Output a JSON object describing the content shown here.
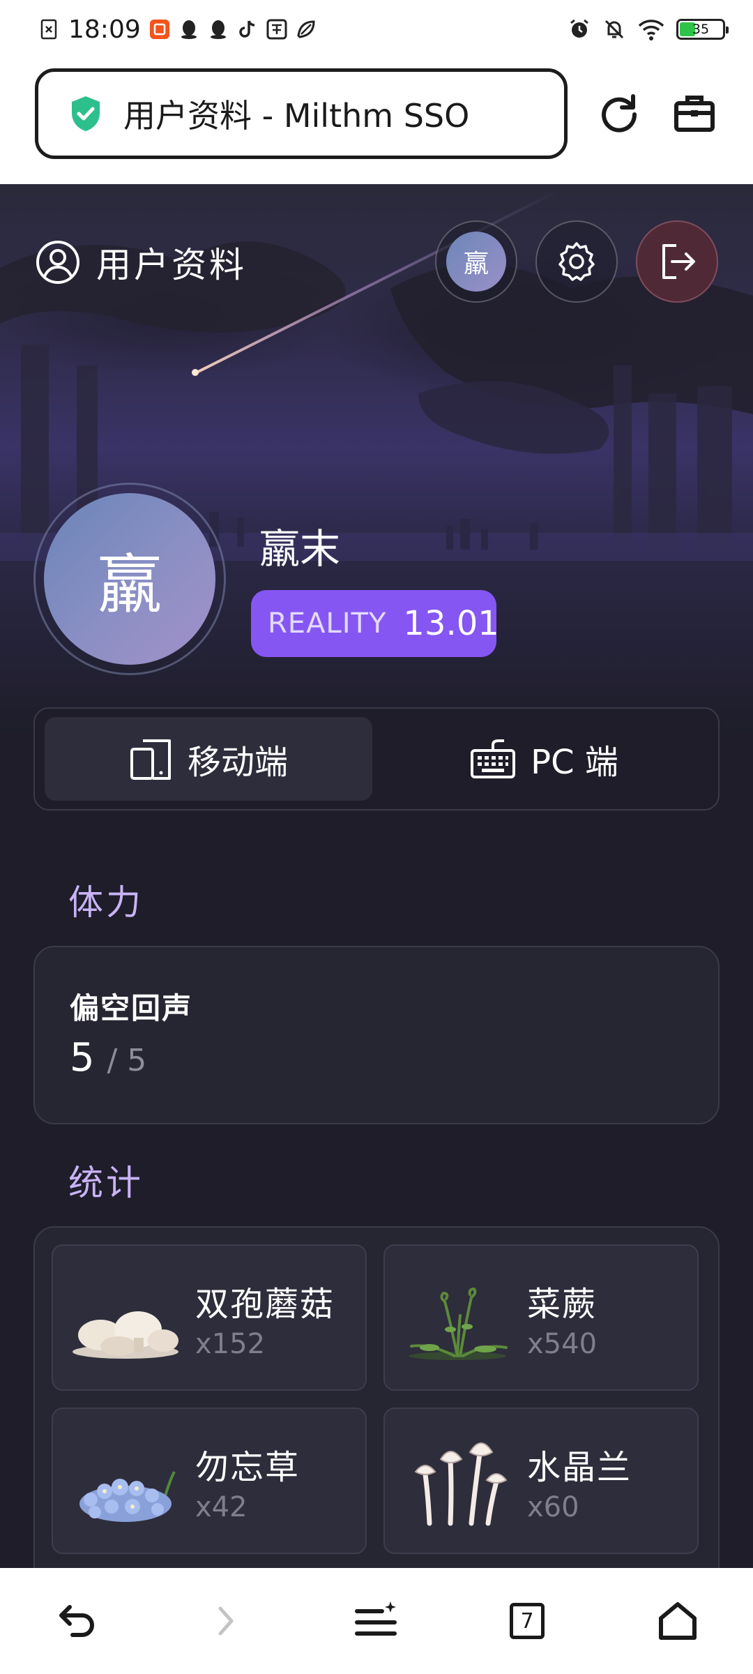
{
  "status_bar": {
    "time": "18:09",
    "battery": "35",
    "notification_icons": [
      "close-box-icon",
      "app-badge-icon",
      "qq-icon",
      "qq-icon",
      "tiktok-icon",
      "tieba-icon",
      "leaf-icon"
    ],
    "system_icons": [
      "alarm-icon",
      "bell-off-icon",
      "wifi-icon",
      "battery-icon"
    ]
  },
  "browser": {
    "url_title": "用户资料 - Milthm SSO",
    "tab_count": "7"
  },
  "header": {
    "title": "用户资料",
    "mini_avatar_char": "羸"
  },
  "profile": {
    "avatar_char": "羸",
    "username": "羸末",
    "rating_label": "REALITY",
    "rating_value": "13.01"
  },
  "platform_tabs": [
    {
      "label": "移动端",
      "active": true
    },
    {
      "label": "PC 端",
      "active": false
    }
  ],
  "stamina": {
    "section_title": "体力",
    "name": "偏空回声",
    "current": "5",
    "max": "/ 5"
  },
  "stats": {
    "section_title": "统计",
    "items": [
      {
        "name": "双孢蘑菇",
        "count": "x152"
      },
      {
        "name": "菜蕨",
        "count": "x540"
      },
      {
        "name": "勿忘草",
        "count": "x42"
      },
      {
        "name": "水晶兰",
        "count": "x60"
      }
    ]
  },
  "colors": {
    "accent_purple": "#8656f3",
    "section_title": "#c9b3f6",
    "page_bg": "#1e1d29",
    "card_bg": "#262532",
    "logout_btn": "#4f2a36",
    "shield_green": "#2dbf8c"
  }
}
